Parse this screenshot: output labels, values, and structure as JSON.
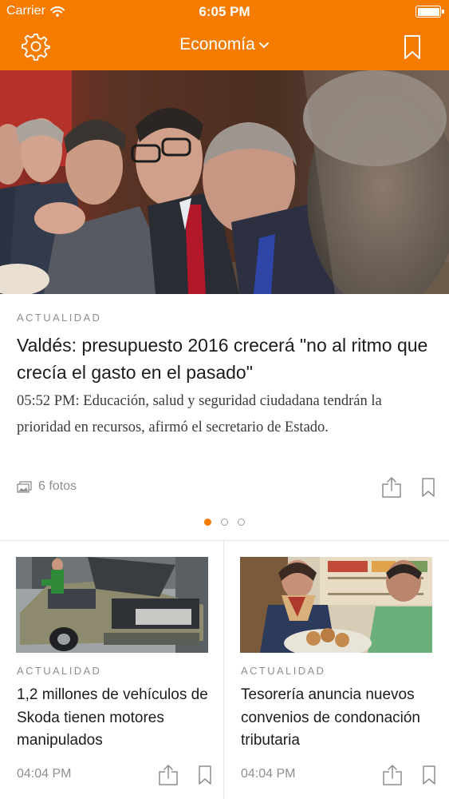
{
  "status_bar": {
    "carrier": "Carrier",
    "time": "6:05 PM",
    "battery_level": 1.0
  },
  "nav": {
    "section": "Economía",
    "icons": {
      "settings": "gear-icon",
      "dropdown": "chevron-down-icon",
      "bookmarks": "bookmark-icon"
    }
  },
  "hero": {
    "kicker": "ACTUALIDAD",
    "title": "Valdés: presupuesto 2016 crecerá \"no al ritmo que crecía el gasto en el pasado\"",
    "summary": "05:52 PM: Educación, salud y seguridad ciudadana tendrán la prioridad en recursos, afirmó el secretario de Estado.",
    "photos_label": "6 fotos",
    "icons": {
      "photos": "photo-gallery-icon",
      "share": "share-icon",
      "bookmark": "bookmark-icon"
    }
  },
  "pager": {
    "pages": 3,
    "active_index": 0
  },
  "cards": [
    {
      "kicker": "ACTUALIDAD",
      "title": "1,2 millones de vehículos de Skoda tienen motores manipulados",
      "time": "04:04 PM"
    },
    {
      "kicker": "ACTUALIDAD",
      "title": "Tesorería anuncia nuevos convenios de condonación tributaria",
      "time": "04:04 PM"
    }
  ],
  "colors": {
    "accent": "#f57c00",
    "kicker": "#8e8e8e",
    "text": "#1c1c1c"
  }
}
